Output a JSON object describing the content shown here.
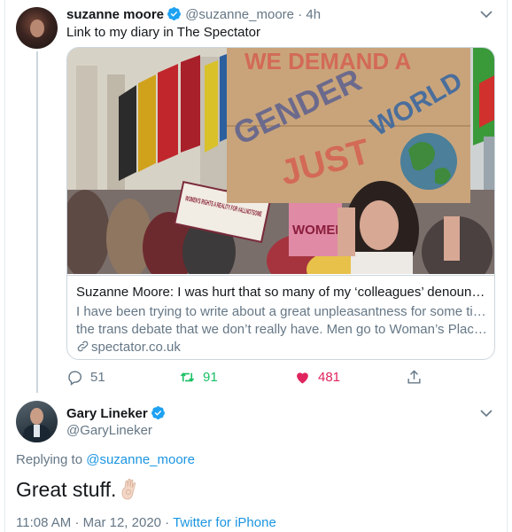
{
  "tweet1": {
    "author_name": "suzanne moore",
    "author_handle": "@suzanne_moore",
    "separator": "·",
    "time": "4h",
    "text": "Link to my diary in The Spectator",
    "card": {
      "image_text": {
        "main_sign_line1": "WE DEMAND A",
        "main_sign_line2": "GENDER",
        "main_sign_line3": "JUST",
        "main_sign_line4": "WORLD",
        "small_sign": "WOMEN'S RIGHTS A REALITY FOR #ALLNOTSOME",
        "pink_sign": "WOMEN"
      },
      "title": "Suzanne Moore: I was hurt that so many of my ‘colleagues’ denounce...",
      "description_line1": "I have been trying to write about a great unpleasantness for some time:",
      "description_line2": "the trans debate that we don’t really have. Men go to Woman’s Place ...",
      "domain": "spectator.co.uk"
    },
    "actions": {
      "replies": "51",
      "retweets": "91",
      "likes": "481"
    }
  },
  "tweet2": {
    "author_name": "Gary Lineker",
    "author_handle": "@GaryLineker",
    "replying_prefix": "Replying to",
    "replying_to": "@suzanne_moore",
    "text": "Great stuff.",
    "time": "11:08 AM",
    "separator": "·",
    "date": "Mar 12, 2020",
    "source": "Twitter for iPhone"
  },
  "icons": {
    "verified": "verified-badge-icon",
    "chevron": "chevron-down-icon",
    "reply": "reply-icon",
    "retweet": "retweet-icon",
    "like": "heart-icon",
    "share": "share-icon",
    "link": "link-icon",
    "emoji": "ok-hand-emoji"
  },
  "colors": {
    "text": "#14171a",
    "secondary": "#657786",
    "link": "#1b95e0",
    "verified": "#1da1f2",
    "retweet": "#17bf63",
    "like": "#e0245e",
    "border": "#ccd6dd"
  }
}
